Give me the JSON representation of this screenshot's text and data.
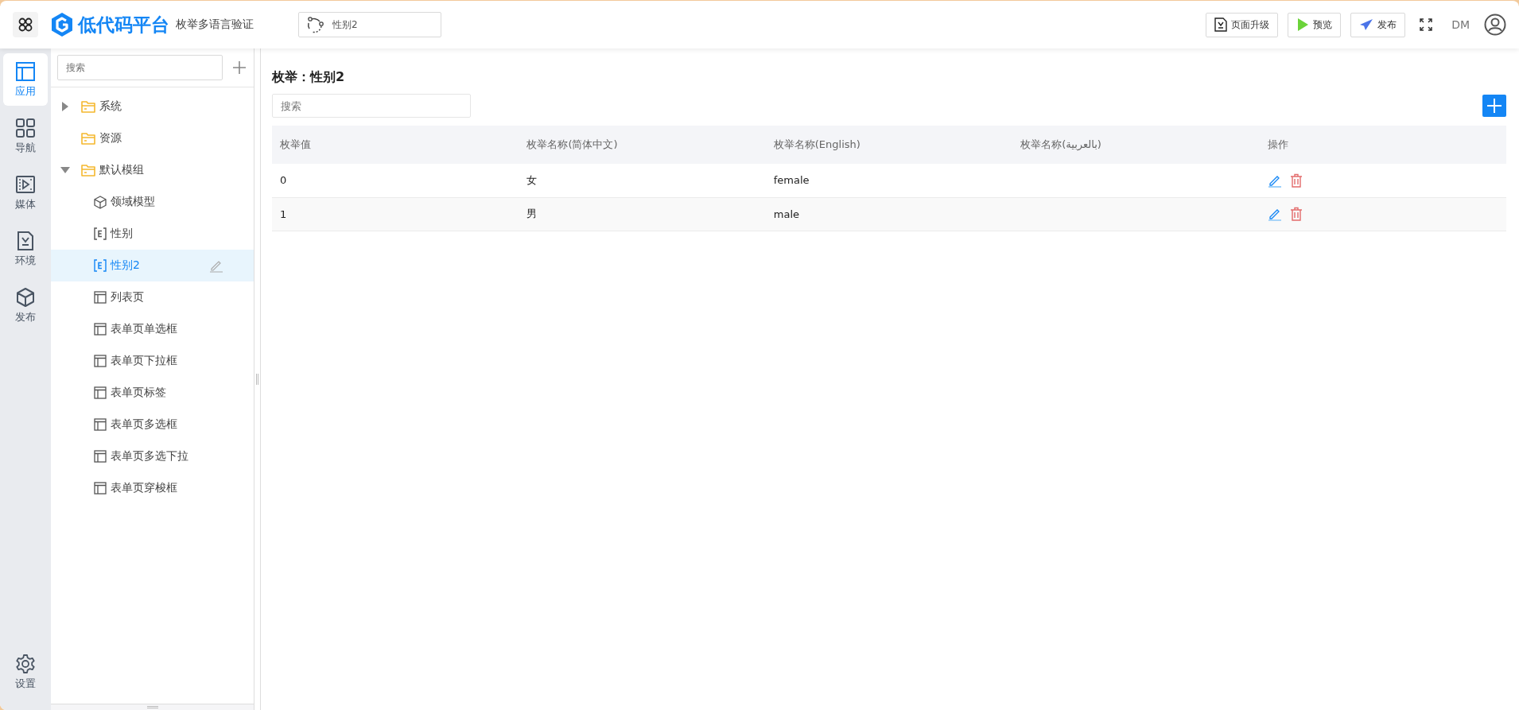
{
  "header": {
    "brand": "低代码平台",
    "project": "枚举多语言验证",
    "tab": "性别2",
    "buttons": [
      {
        "kind": "upgrade",
        "label": "页面升级"
      },
      {
        "kind": "preview",
        "label": "预览"
      },
      {
        "kind": "publish",
        "label": "发布"
      }
    ],
    "user": "DM"
  },
  "rail": [
    {
      "kind": "app",
      "label": "应用",
      "selected": true
    },
    {
      "kind": "nav",
      "label": "导航",
      "selected": false
    },
    {
      "kind": "media",
      "label": "媒体",
      "selected": false
    },
    {
      "kind": "env",
      "label": "环境",
      "selected": false
    },
    {
      "kind": "publish",
      "label": "发布",
      "selected": false
    }
  ],
  "rail_bottom": {
    "label": "设置"
  },
  "tree": {
    "placeholder": "搜索",
    "items": [
      {
        "kind": "folder",
        "label": "系统",
        "expandable": true,
        "expanded": false,
        "selected": false
      },
      {
        "kind": "folder",
        "label": "资源",
        "expandable": false,
        "selected": false
      },
      {
        "kind": "folder",
        "label": "默认模组",
        "expandable": true,
        "expanded": true,
        "selected": false,
        "children": [
          {
            "kind": "model",
            "label": "领域模型",
            "selected": false
          },
          {
            "kind": "enum",
            "label": "性别",
            "selected": false
          },
          {
            "kind": "enum",
            "label": "性别2",
            "selected": true
          },
          {
            "kind": "page",
            "label": "列表页",
            "selected": false
          },
          {
            "kind": "page",
            "label": "表单页单选框",
            "selected": false
          },
          {
            "kind": "page",
            "label": "表单页下拉框",
            "selected": false
          },
          {
            "kind": "page",
            "label": "表单页标签",
            "selected": false
          },
          {
            "kind": "page",
            "label": "表单页多选框",
            "selected": false
          },
          {
            "kind": "page",
            "label": "表单页多选下拉",
            "selected": false
          },
          {
            "kind": "page",
            "label": "表单页穿梭框",
            "selected": false
          }
        ]
      }
    ]
  },
  "main": {
    "title": "枚举：性别2",
    "placeholder": "搜索",
    "table": {
      "columns": [
        "枚举值",
        "枚举名称(简体中文)",
        "枚举名称(English)",
        "枚举名称(بالعربية)",
        "操作"
      ],
      "rows": [
        [
          "0",
          "女",
          "female",
          ""
        ],
        [
          "1",
          "男",
          "male",
          ""
        ]
      ]
    }
  }
}
